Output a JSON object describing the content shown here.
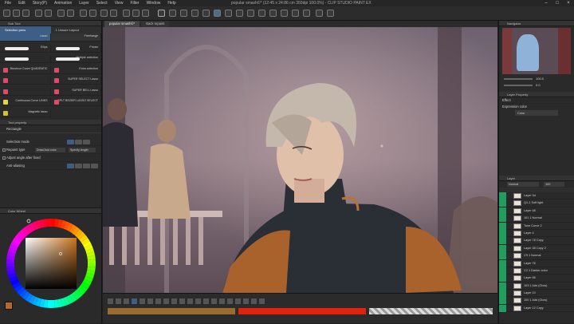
{
  "app": {
    "title": "popular smash©* (12:45 x 24:86 cm 350dpi 100.0%) - CLIP STUDIO PAINT EX",
    "menu": [
      "File",
      "Edit",
      "Story(P)",
      "Animation",
      "Layer",
      "Select",
      "View",
      "Filter",
      "Window",
      "Help"
    ]
  },
  "canvas_tabs": [
    "popular smash©*",
    "Back repaint"
  ],
  "left_panel": {
    "subtool_header": "Sub Tool",
    "tabs": [
      "Selection pens",
      "1 Unsure Layout"
    ],
    "brushes": [
      {
        "label": "Selection pens",
        "kind": "tab"
      },
      {
        "label": "1 Unsure Layout",
        "kind": "tab"
      },
      {
        "label": "Lasso",
        "kind": "text"
      },
      {
        "label": "Freehange",
        "kind": "text"
      },
      {
        "label": "Ellips",
        "kind": "stroke"
      },
      {
        "label": "F'draw",
        "kind": "stroke"
      },
      {
        "label": "",
        "kind": "stroke"
      },
      {
        "label": "Multiple selection",
        "kind": "stroke"
      },
      {
        "label": "Brushcur Curve QUADRATIC",
        "kind": "icon"
      },
      {
        "label": "Extra selection",
        "kind": "icon"
      },
      {
        "label": "",
        "kind": "icon"
      },
      {
        "label": "SUPER SELECT Lasso",
        "kind": "icon"
      },
      {
        "label": "",
        "kind": "icon"
      },
      {
        "label": "SUPER BELL Lasso",
        "kind": "icon"
      },
      {
        "label": "Continuous Curve LINKS",
        "kind": "icon"
      },
      {
        "label": "SPLT BEZIER LASSO SELECT",
        "kind": "icon"
      },
      {
        "label": "Magnetic lasso",
        "kind": "icon"
      }
    ],
    "tool_property_header": "Tool property",
    "tool_property_name": "Rectangle",
    "props": [
      {
        "label": "Selection mode",
        "control": "pills"
      },
      {
        "label": "Repaint type",
        "control": "dropdowns"
      },
      {
        "label": "Adjust angle after fixed",
        "control": "check"
      },
      {
        "label": "Anti-aliasing",
        "control": "pills"
      }
    ],
    "repaint_value": "Draw/Just color",
    "repaint_value2": "Specify length",
    "color_header": "Color Wheel"
  },
  "right_panel": {
    "navigator_header": "Navigator",
    "zoom": "100.0",
    "rotate": "0.0",
    "layer_property_header": "Layer Property",
    "effect_label": "Effect",
    "expression_label": "Expression color",
    "expression_value": "Color",
    "layer_header": "Layer",
    "blend_mode": "Normal",
    "opacity": "100",
    "layers": [
      "Layer 3d",
      "Q1-1 Soft light",
      "Layer 48",
      "101 1 Normal",
      "Tone Curve 2",
      "Layer 4",
      "Layer 78 Copy",
      "Layer 38 Copy 2",
      "1'9 1 Normal",
      "Layer 76",
      "1'2 1 Darker color",
      "Layer 86",
      "103 1 Add (Glow)",
      "Layer 10",
      "100 1 Add (Glow)",
      "Layer 12 Copy"
    ]
  },
  "colors": {
    "main_color": "#b46a26",
    "sub_color": "#e03018",
    "accent": "#3d5f86",
    "layer_visible": "#1f9e60"
  }
}
